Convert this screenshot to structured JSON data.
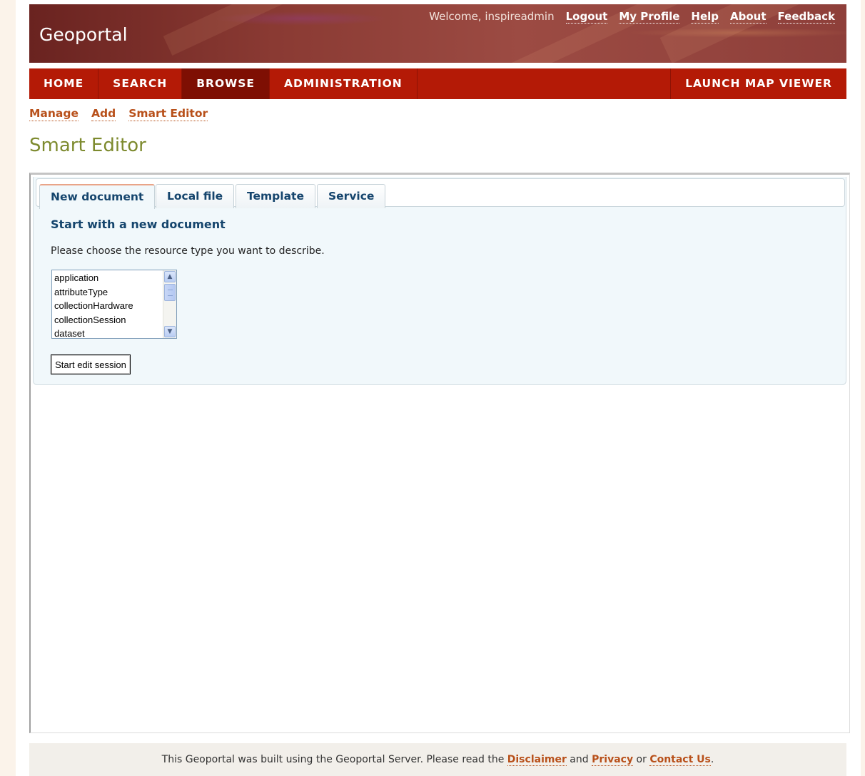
{
  "header": {
    "brand": "Geoportal",
    "welcome": "Welcome, inspireadmin",
    "links": [
      "Logout",
      "My Profile",
      "Help",
      "About",
      "Feedback"
    ]
  },
  "nav": {
    "items": [
      "HOME",
      "SEARCH",
      "BROWSE",
      "ADMINISTRATION"
    ],
    "active": "BROWSE",
    "launch": "LAUNCH MAP VIEWER"
  },
  "subnav": [
    "Manage",
    "Add",
    "Smart Editor"
  ],
  "page": {
    "title": "Smart Editor"
  },
  "tabs": {
    "items": [
      "New document",
      "Local file",
      "Template",
      "Service"
    ],
    "active": "New document"
  },
  "panel": {
    "heading": "Start with a new document",
    "instruction": "Please choose the resource type you want to describe.",
    "resource_types": [
      "application",
      "attributeType",
      "collectionHardware",
      "collectionSession",
      "dataset"
    ],
    "start_button": "Start edit session"
  },
  "footer": {
    "text_before": "This Geoportal was built using the Geoportal Server. Please read the ",
    "disclaimer": "Disclaimer",
    "and": " and ",
    "privacy": "Privacy",
    "or": " or ",
    "contact": "Contact Us",
    "end": "."
  },
  "colors": {
    "nav_red": "#b41a06",
    "nav_active": "#7e0f03",
    "link_orange": "#b8501a",
    "title_olive": "#7d8a2e",
    "heading_blue": "#15456d",
    "panel_bg": "#f1f8fb"
  },
  "icons": [
    "scroll-up-arrow-icon",
    "scroll-down-arrow-icon"
  ]
}
